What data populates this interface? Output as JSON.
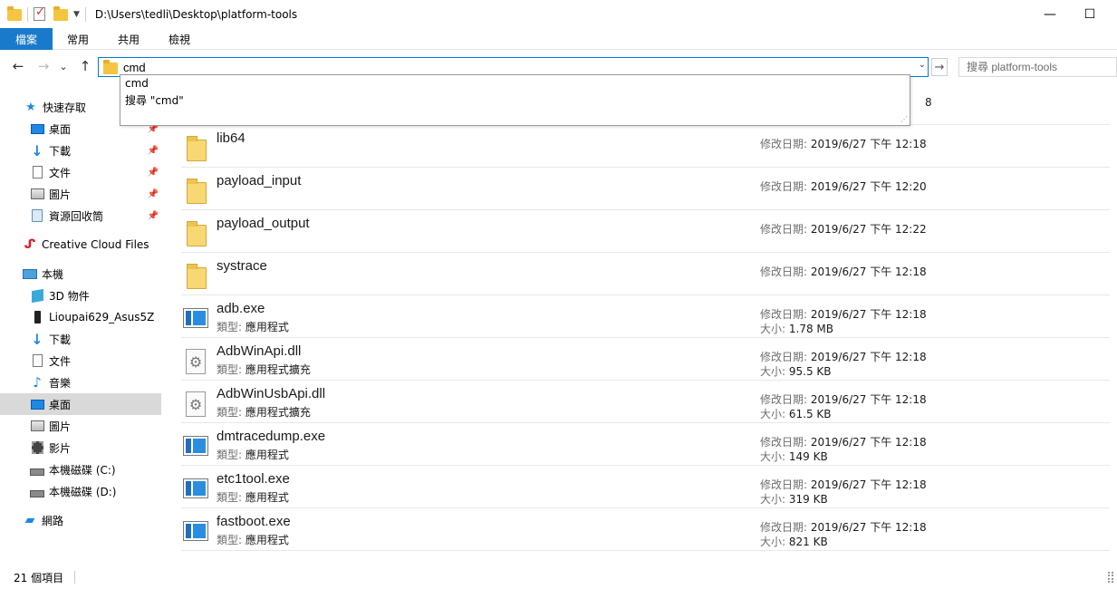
{
  "window": {
    "title": "D:\\Users\\tedli\\Desktop\\platform-tools",
    "minimize": "—",
    "maximize": "☐"
  },
  "ribbon": {
    "tabs": [
      "檔案",
      "常用",
      "共用",
      "檢視"
    ]
  },
  "nav": {
    "back": "←",
    "forward": "→",
    "recent": "⌄",
    "up": "↑",
    "go": "→"
  },
  "address": {
    "value": "cmd"
  },
  "search": {
    "placeholder": "搜尋 platform-tools"
  },
  "suggestions": [
    "cmd",
    "搜尋 \"cmd\""
  ],
  "sidebar": {
    "items": [
      {
        "label": "快速存取",
        "icon": "quick-access-star-icon"
      },
      {
        "label": "桌面",
        "icon": "desktop-icon",
        "pinned": true
      },
      {
        "label": "下載",
        "icon": "downloads-icon",
        "pinned": true
      },
      {
        "label": "文件",
        "icon": "documents-icon",
        "pinned": true
      },
      {
        "label": "圖片",
        "icon": "pictures-icon",
        "pinned": true
      },
      {
        "label": "資源回收筒",
        "icon": "recycle-bin-icon",
        "pinned": true
      },
      {
        "label": "Creative Cloud Files",
        "icon": "creative-cloud-icon"
      },
      {
        "label": "本機",
        "icon": "this-pc-icon"
      },
      {
        "label": "3D 物件",
        "icon": "3d-objects-icon"
      },
      {
        "label": "Lioupai629_Asus5Z",
        "icon": "phone-icon"
      },
      {
        "label": "下載",
        "icon": "downloads-icon"
      },
      {
        "label": "文件",
        "icon": "documents-icon"
      },
      {
        "label": "音樂",
        "icon": "music-icon"
      },
      {
        "label": "桌面",
        "icon": "desktop-icon",
        "selected": true
      },
      {
        "label": "圖片",
        "icon": "pictures-icon"
      },
      {
        "label": "影片",
        "icon": "videos-icon"
      },
      {
        "label": "本機磁碟 (C:)",
        "icon": "drive-c-icon"
      },
      {
        "label": "本機磁碟 (D:)",
        "icon": "drive-d-icon"
      },
      {
        "label": "網路",
        "icon": "network-icon"
      }
    ]
  },
  "labels": {
    "date_label": "修改日期:",
    "type_label": "類型:",
    "size_label": "大小:"
  },
  "files": {
    "partial_top_time": "8",
    "rows": [
      {
        "name": "lib64",
        "kind": "folder",
        "date": "2019/6/27 下午 12:18"
      },
      {
        "name": "payload_input",
        "kind": "folder",
        "date": "2019/6/27 下午 12:20"
      },
      {
        "name": "payload_output",
        "kind": "folder",
        "date": "2019/6/27 下午 12:22"
      },
      {
        "name": "systrace",
        "kind": "folder",
        "date": "2019/6/27 下午 12:18"
      },
      {
        "name": "adb.exe",
        "kind": "exe",
        "type": "應用程式",
        "date": "2019/6/27 下午 12:18",
        "size": "1.78 MB"
      },
      {
        "name": "AdbWinApi.dll",
        "kind": "dll",
        "type": "應用程式擴充",
        "date": "2019/6/27 下午 12:18",
        "size": "95.5 KB"
      },
      {
        "name": "AdbWinUsbApi.dll",
        "kind": "dll",
        "type": "應用程式擴充",
        "date": "2019/6/27 下午 12:18",
        "size": "61.5 KB"
      },
      {
        "name": "dmtracedump.exe",
        "kind": "exe",
        "type": "應用程式",
        "date": "2019/6/27 下午 12:18",
        "size": "149 KB"
      },
      {
        "name": "etc1tool.exe",
        "kind": "exe",
        "type": "應用程式",
        "date": "2019/6/27 下午 12:18",
        "size": "319 KB"
      },
      {
        "name": "fastboot.exe",
        "kind": "exe",
        "type": "應用程式",
        "date": "2019/6/27 下午 12:18",
        "size": "821 KB"
      }
    ]
  },
  "status": {
    "count": "21 個項目"
  },
  "colors": {
    "file_tab": "#1979ca",
    "focus_border": "#0078d7",
    "selected_nav": "#d9d9d9",
    "folder": "#f8d775"
  }
}
